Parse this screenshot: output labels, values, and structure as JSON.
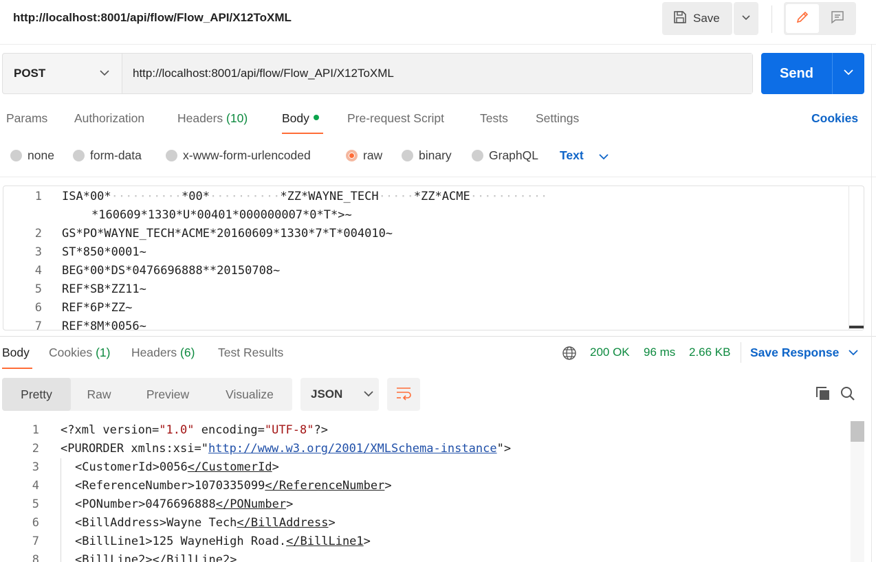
{
  "header": {
    "title": "http://localhost:8001/api/flow/Flow_API/X12ToXML",
    "save_label": "Save"
  },
  "request": {
    "method": "POST",
    "url": "http://localhost:8001/api/flow/Flow_API/X12ToXML",
    "send_label": "Send"
  },
  "request_tabs": {
    "params": "Params",
    "authorization": "Authorization",
    "headers": "Headers",
    "headers_count": "(10)",
    "body": "Body",
    "pre_request": "Pre-request Script",
    "tests": "Tests",
    "settings": "Settings",
    "cookies": "Cookies"
  },
  "body_types": {
    "none": "none",
    "form_data": "form-data",
    "urlencoded": "x-www-form-urlencoded",
    "raw": "raw",
    "binary": "binary",
    "graphql": "GraphQL",
    "selected": "raw",
    "format": "Text"
  },
  "request_body": {
    "line_numbers": [
      "1",
      "",
      "2",
      "3",
      "4",
      "5",
      "6",
      "7"
    ],
    "lines": [
      "ISA*00*",
      "*160609*1330*U*00401*000000007*0*T*>~",
      "GS*PO*WAYNE_TECH*ACME*20160609*1330*7*T*004010~",
      "ST*850*0001~",
      "BEG*00*DS*0476696888**20150708~",
      "REF*SB*ZZ11~",
      "REF*6P*ZZ~",
      "REF*8M*0056~"
    ],
    "line1_parts": [
      "ISA*00*",
      "··········",
      "*00*",
      "··········",
      "*ZZ*WAYNE_TECH",
      "·····",
      "*ZZ*ACME",
      "···········"
    ]
  },
  "response_tabs": {
    "body": "Body",
    "cookies": "Cookies",
    "cookies_count": "(1)",
    "headers": "Headers",
    "headers_count": "(6)",
    "test_results": "Test Results"
  },
  "response_status": {
    "status": "200 OK",
    "time": "96 ms",
    "size": "2.66 KB",
    "save_response": "Save Response"
  },
  "response_views": {
    "pretty": "Pretty",
    "raw": "Raw",
    "preview": "Preview",
    "visualize": "Visualize",
    "format": "JSON"
  },
  "response_body": {
    "line_numbers": [
      "1",
      "2",
      "3",
      "4",
      "5",
      "6",
      "7",
      "8"
    ],
    "xml_decl": [
      "<?xml version=",
      "\"1.0\"",
      " encoding=",
      "\"UTF-8\"",
      "?>"
    ],
    "root_open": [
      "<PURORDER xmlns:xsi=\"",
      "http://www.w3.org/2001/XMLSchema-instance",
      "\">"
    ],
    "elements": [
      {
        "open": "<CustomerId>",
        "value": "0056",
        "close": "</CustomerId",
        "end": ">"
      },
      {
        "open": "<ReferenceNumber>",
        "value": "1070335099",
        "close": "</ReferenceNumber",
        "end": ">"
      },
      {
        "open": "<PONumber>",
        "value": "0476696888",
        "close": "</PONumber",
        "end": ">"
      },
      {
        "open": "<BillAddress>",
        "value": "Wayne Tech",
        "close": "</BillAddress",
        "end": ">"
      },
      {
        "open": "<BillLine1>",
        "value": "125 WayneHigh Road.",
        "close": "</BillLine1",
        "end": ">"
      },
      {
        "open": "<BillLine2>",
        "value": "",
        "close": "</BillLine2",
        "end": ">"
      }
    ]
  },
  "colors": {
    "accent": "#ff6c37",
    "primary": "#0d6ee6",
    "link": "#0d64c8",
    "success": "#0d8a3f",
    "string": "#a31515"
  },
  "icons": [
    "save-icon",
    "chevron-down-icon",
    "pencil-icon",
    "comment-icon",
    "globe-icon",
    "wrap-lines-icon",
    "copy-icon",
    "search-icon"
  ]
}
